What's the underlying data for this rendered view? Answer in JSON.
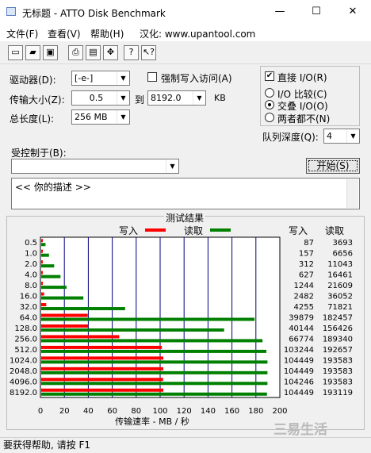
{
  "window": {
    "title": "无标题 - ATTO Disk Benchmark",
    "minimize": "—",
    "maximize": "☐",
    "close": "✕"
  },
  "menu": [
    {
      "label": "文件(F)"
    },
    {
      "label": "查看(V)"
    },
    {
      "label": "帮助(H)"
    },
    {
      "label": "汉化: www.upantool.com"
    }
  ],
  "toolbar": [
    "new-icon",
    "open-icon",
    "save-icon",
    "print-icon",
    "print-preview-icon",
    "move-icon",
    "help-icon",
    "context-help-icon"
  ],
  "form": {
    "drive_label": "驱动器(D):",
    "drive_value": "[-e-]",
    "transfer_label": "传输大小(Z):",
    "transfer_from": "0.5",
    "to_label": "到",
    "transfer_to": "8192.0",
    "kb_label": "KB",
    "total_label": "总长度(L):",
    "total_value": "256 MB",
    "force_write_label": "强制写入访问(A)",
    "direct_io_label": "直接 I/O(R)",
    "io_compare_label": "I/O 比较(C)",
    "overlapped_io_label": "交叠 I/O(O)",
    "neither_label": "两者都不(N)",
    "queue_label": "队列深度(Q):",
    "queue_value": "4",
    "controlled_label": "受控制于(B):",
    "controlled_value": "",
    "start_button": "开始(S)",
    "description": "<<  你的描述  >>"
  },
  "chart_data": {
    "type": "bar",
    "title": "测试结果",
    "legend": [
      {
        "name": "写入",
        "color": "#ff0000"
      },
      {
        "name": "读取",
        "color": "#008000"
      }
    ],
    "xlabel": "传输速率 - MB / 秒",
    "xlim": [
      0,
      200
    ],
    "xticks": [
      "0",
      "20",
      "40",
      "60",
      "80",
      "100",
      "120",
      "140",
      "160",
      "180",
      "200"
    ],
    "categories": [
      "0.5",
      "1.0",
      "2.0",
      "4.0",
      "8.0",
      "16.0",
      "32.0",
      "64.0",
      "128.0",
      "256.0",
      "512.0",
      "1024.0",
      "2048.0",
      "4096.0",
      "8192.0"
    ],
    "columns": [
      "写入",
      "读取"
    ],
    "write_kbps": [
      87,
      157,
      312,
      627,
      1244,
      2482,
      4255,
      39879,
      40144,
      66774,
      103244,
      104449,
      104449,
      104246,
      104449
    ],
    "read_kbps": [
      3693,
      6656,
      11043,
      16461,
      21609,
      36052,
      71821,
      182457,
      156426,
      189340,
      192657,
      193583,
      193583,
      193583,
      193119
    ],
    "series": [
      {
        "name": "写入",
        "color": "#ff0000",
        "values": [
          0.08,
          0.15,
          0.3,
          0.6,
          1.2,
          2.4,
          4.2,
          38.9,
          39.2,
          65.2,
          100.8,
          102.0,
          102.0,
          101.8,
          102.0
        ]
      },
      {
        "name": "读取",
        "color": "#008000",
        "values": [
          3.6,
          6.5,
          10.8,
          16.1,
          21.1,
          35.2,
          70.1,
          178.2,
          152.8,
          184.9,
          188.1,
          189.0,
          189.0,
          189.0,
          188.6
        ]
      }
    ]
  },
  "status": "要获得帮助, 请按 F1",
  "watermark": "三易生活"
}
